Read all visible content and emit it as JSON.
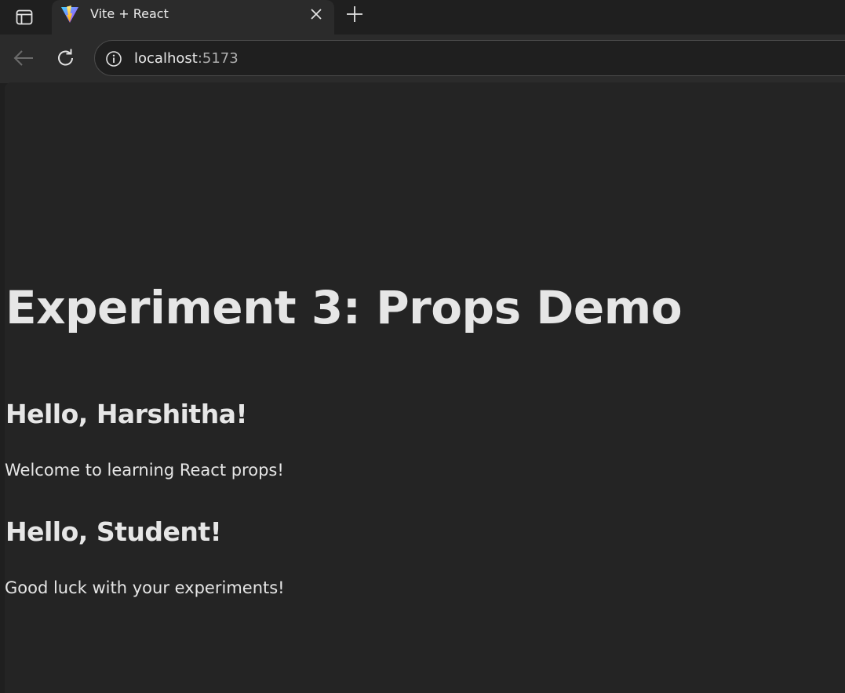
{
  "browser": {
    "tab": {
      "title": "Vite + React",
      "favicon": "vite-logo-icon"
    },
    "address": {
      "host": "localhost",
      "port": ":5173"
    }
  },
  "page": {
    "title": "Experiment 3: Props Demo",
    "greetings": [
      {
        "heading": "Hello, Harshitha!",
        "message": "Welcome to learning React props!"
      },
      {
        "heading": "Hello, Student!",
        "message": "Good luck with your experiments!"
      }
    ]
  },
  "colors": {
    "chrome_bg": "#1f1f1f",
    "toolbar_bg": "#2b2b2b",
    "page_bg": "#242424",
    "text": "#e6e6e6"
  }
}
